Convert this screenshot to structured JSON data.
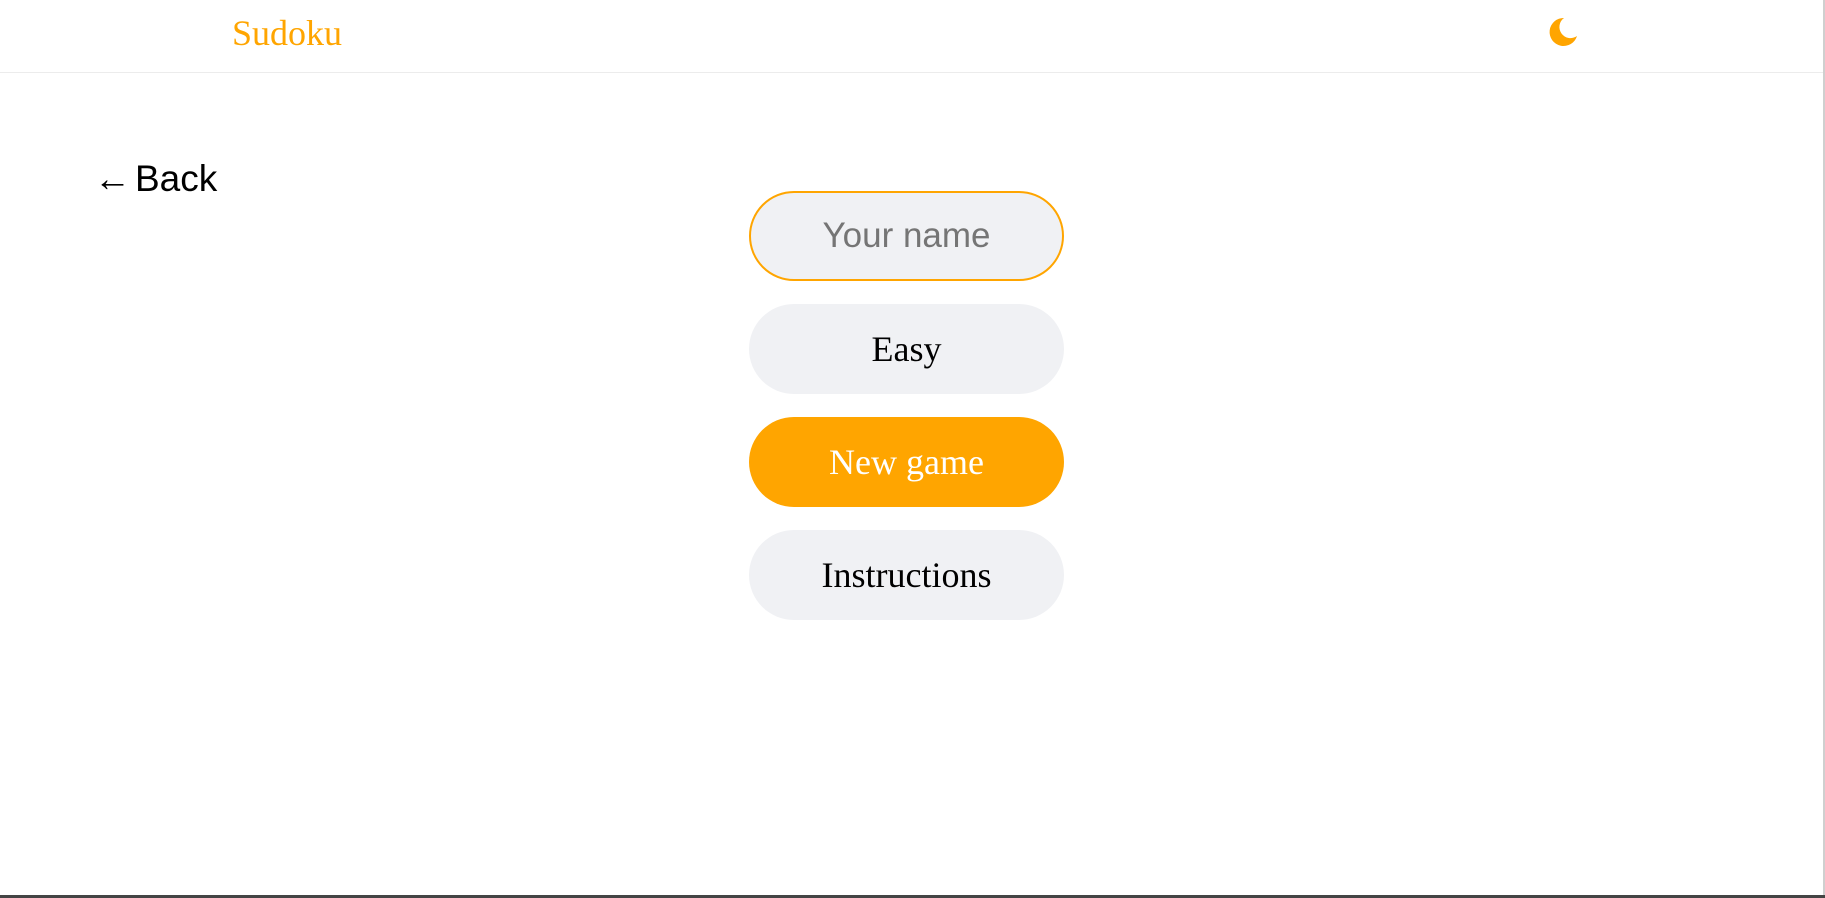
{
  "header": {
    "title": "Sudoku",
    "theme_toggle_icon": "moon-icon"
  },
  "back": {
    "arrow": "←",
    "label": "Back"
  },
  "form": {
    "name_placeholder": "Your name",
    "name_value": "",
    "difficulty_label": "Easy",
    "new_game_label": "New game",
    "instructions_label": "Instructions"
  },
  "colors": {
    "accent": "#ffa500",
    "pill_background": "#f0f1f4",
    "background": "#ffffff"
  }
}
